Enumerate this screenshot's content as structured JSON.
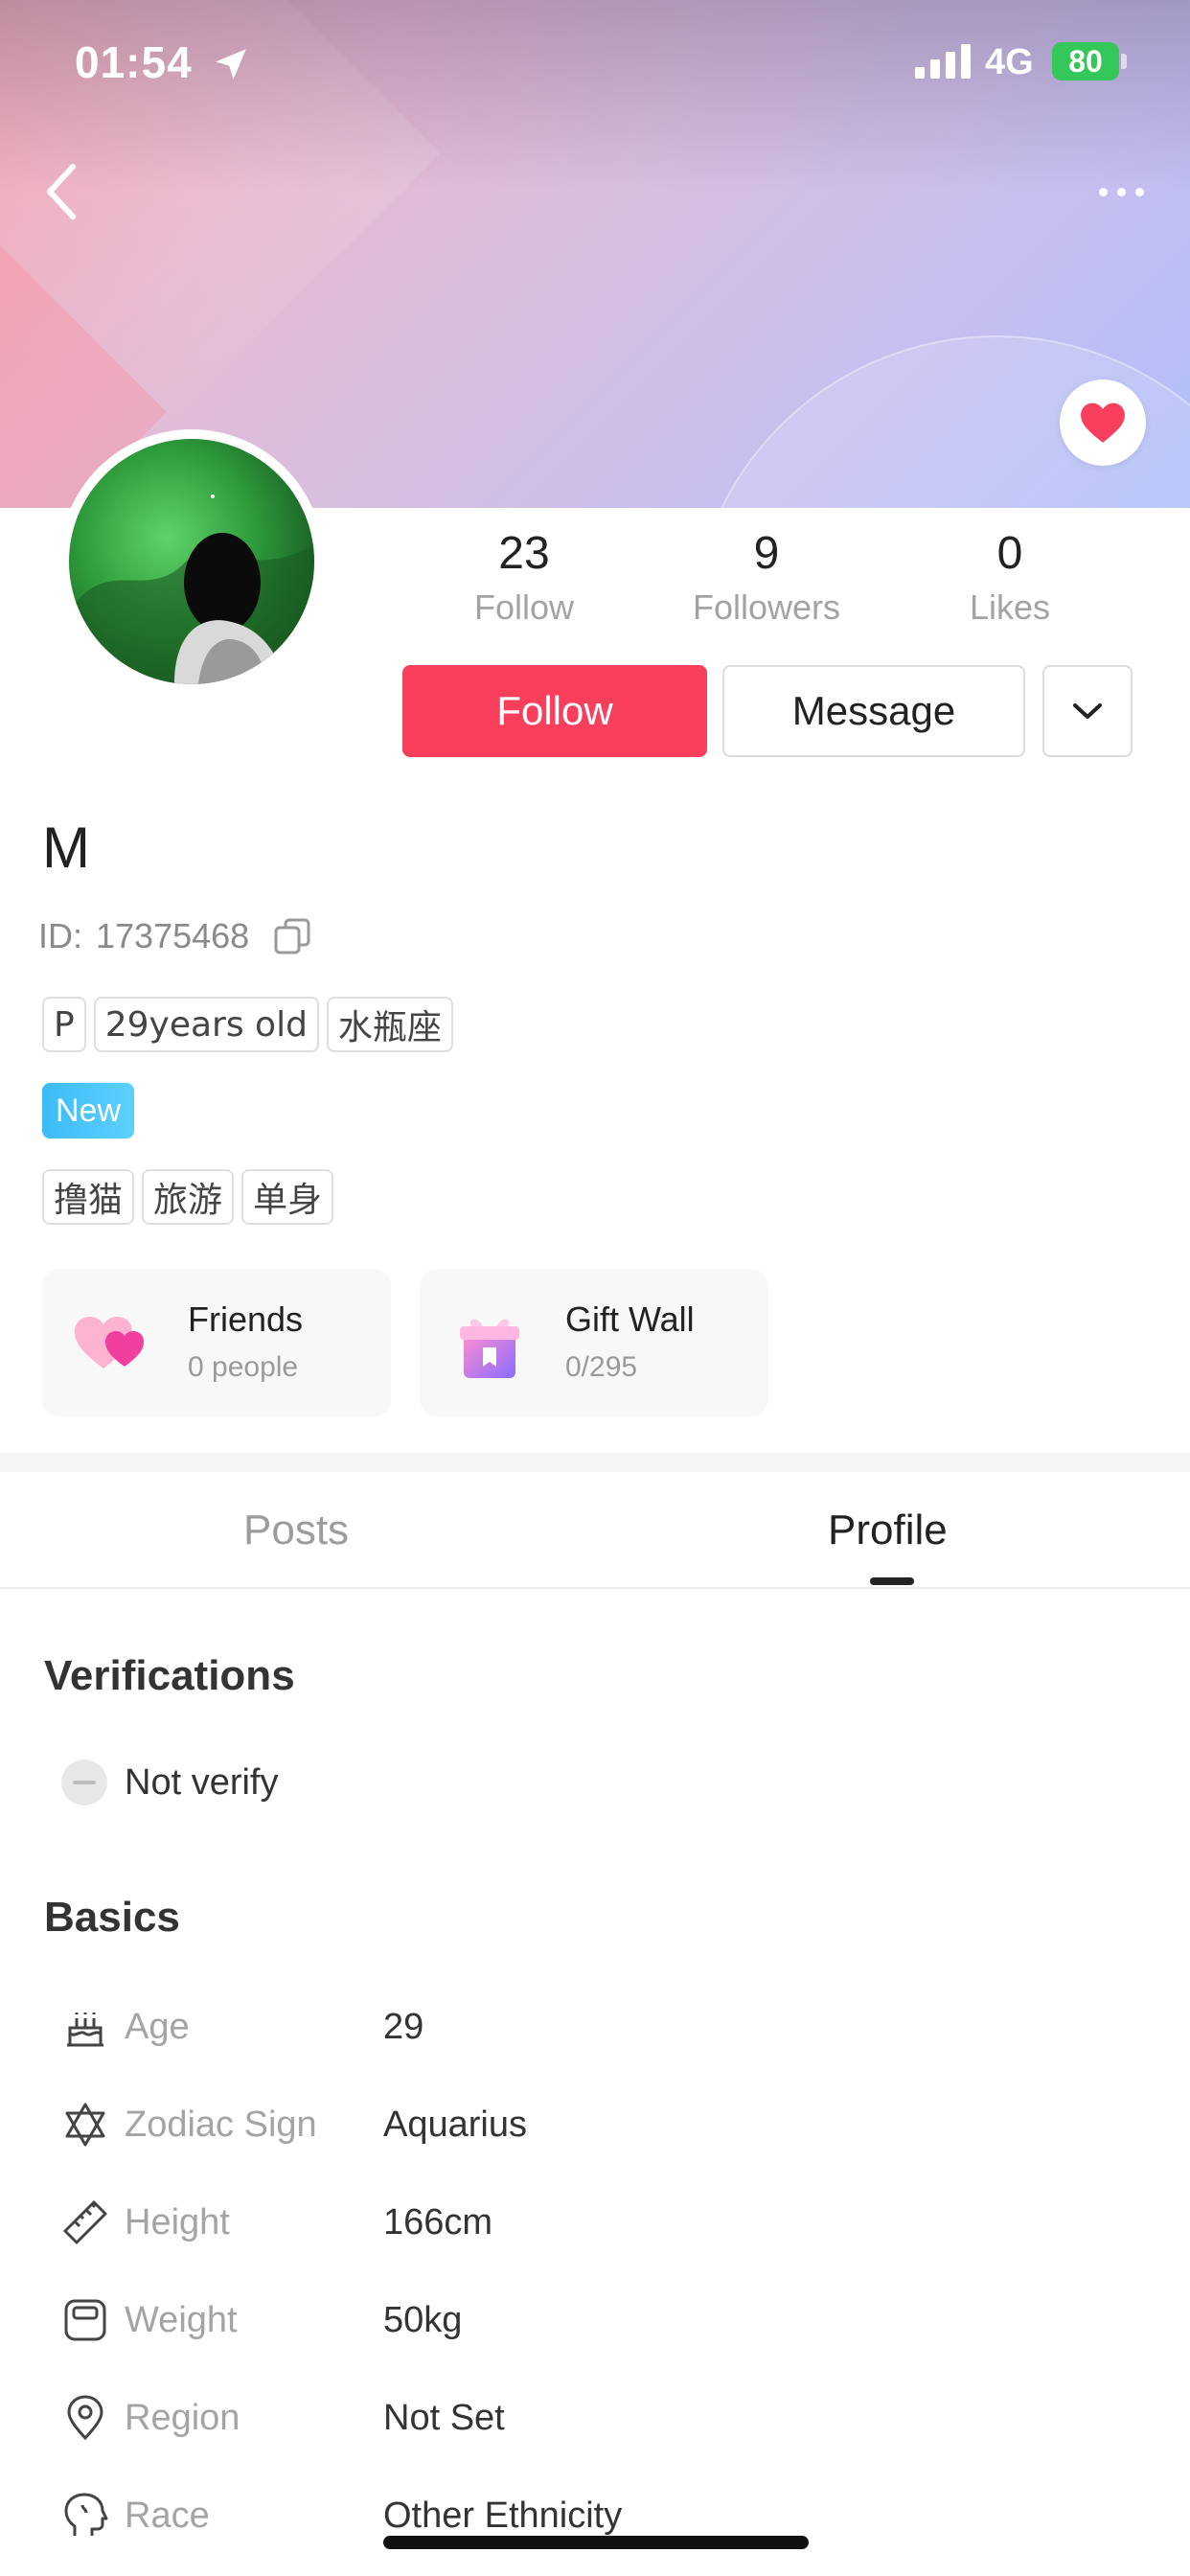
{
  "status_bar": {
    "time": "01:54",
    "network": "4G",
    "battery": "80"
  },
  "stats": [
    {
      "value": "23",
      "label": "Follow"
    },
    {
      "value": "9",
      "label": "Followers"
    },
    {
      "value": "0",
      "label": "Likes"
    }
  ],
  "actions": {
    "follow": "Follow",
    "message": "Message"
  },
  "profile": {
    "name": "M",
    "id_label": "ID:",
    "id_value": "17375468",
    "tags": [
      "P",
      "29years old",
      "水瓶座"
    ],
    "badge": "New",
    "interests": [
      "撸猫",
      "旅游",
      "单身"
    ]
  },
  "cards": [
    {
      "title": "Friends",
      "subtitle": "0 people"
    },
    {
      "title": "Gift Wall",
      "subtitle": "0/295"
    }
  ],
  "tabs": [
    {
      "label": "Posts",
      "active": false
    },
    {
      "label": "Profile",
      "active": true
    }
  ],
  "verifications": {
    "title": "Verifications",
    "status": "Not verify"
  },
  "basics": {
    "title": "Basics",
    "rows": [
      {
        "icon": "cake-icon",
        "label": "Age",
        "value": "29"
      },
      {
        "icon": "star-of-david-icon",
        "label": "Zodiac Sign",
        "value": "Aquarius"
      },
      {
        "icon": "ruler-icon",
        "label": "Height",
        "value": "166cm"
      },
      {
        "icon": "scale-icon",
        "label": "Weight",
        "value": "50kg"
      },
      {
        "icon": "location-pin-icon",
        "label": "Region",
        "value": "Not Set"
      },
      {
        "icon": "head-silhouette-icon",
        "label": "Race",
        "value": "Other Ethnicity"
      }
    ]
  },
  "colors": {
    "primary": "#fa3f5c",
    "badge": "#3dbbf5",
    "battery": "#34c759"
  }
}
